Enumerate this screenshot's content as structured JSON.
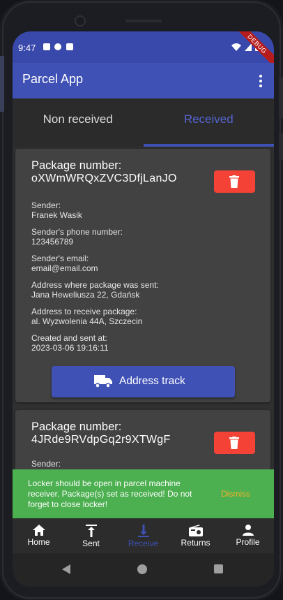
{
  "status_bar": {
    "time": "9:47",
    "debug_label": "DEBUG"
  },
  "app_bar": {
    "title": "Parcel App"
  },
  "tabs": [
    {
      "label": "Non received",
      "active": false
    },
    {
      "label": "Received",
      "active": true
    }
  ],
  "packages": [
    {
      "number_label": "Package number:",
      "number": "oXWmWRQxZVC3DfjLanJO",
      "fields": [
        {
          "label": "Sender:",
          "value": "Franek Wasik"
        },
        {
          "label": "Sender's phone number:",
          "value": "123456789"
        },
        {
          "label": "Sender's email:",
          "value": "email@email.com"
        },
        {
          "label": "Address where package was sent:",
          "value": "Jana Heweliusza 22, Gdańsk"
        },
        {
          "label": "Address to receive package:",
          "value": "al. Wyzwolenia 44A, Szczecin"
        },
        {
          "label": "Created and sent at:",
          "value": "2023-03-06 19:16:11"
        }
      ],
      "track_button": "Address track"
    },
    {
      "number_label": "Package number:",
      "number": "4JRde9RVdpGq2r9XTWgF",
      "fields": [
        {
          "label": "Sender:",
          "value": ""
        }
      ]
    }
  ],
  "snackbar": {
    "message": "Locker should be open in parcel machine receiver. Package(s) set as received! Do not forget to close locker!",
    "action": "Dismiss",
    "color": "#4caf50",
    "action_color": "#f4b02b"
  },
  "bottom_nav": [
    {
      "label": "Home",
      "icon": "home-icon",
      "active": false
    },
    {
      "label": "Sent",
      "icon": "upload-icon",
      "active": false
    },
    {
      "label": "Receive",
      "icon": "download-icon",
      "active": true
    },
    {
      "label": "Returns",
      "icon": "radio-icon",
      "active": false
    },
    {
      "label": "Profile",
      "icon": "person-icon",
      "active": false
    }
  ],
  "colors": {
    "primary": "#3f51b5",
    "danger": "#f44336",
    "surface": "#424242",
    "background": "#303030"
  }
}
